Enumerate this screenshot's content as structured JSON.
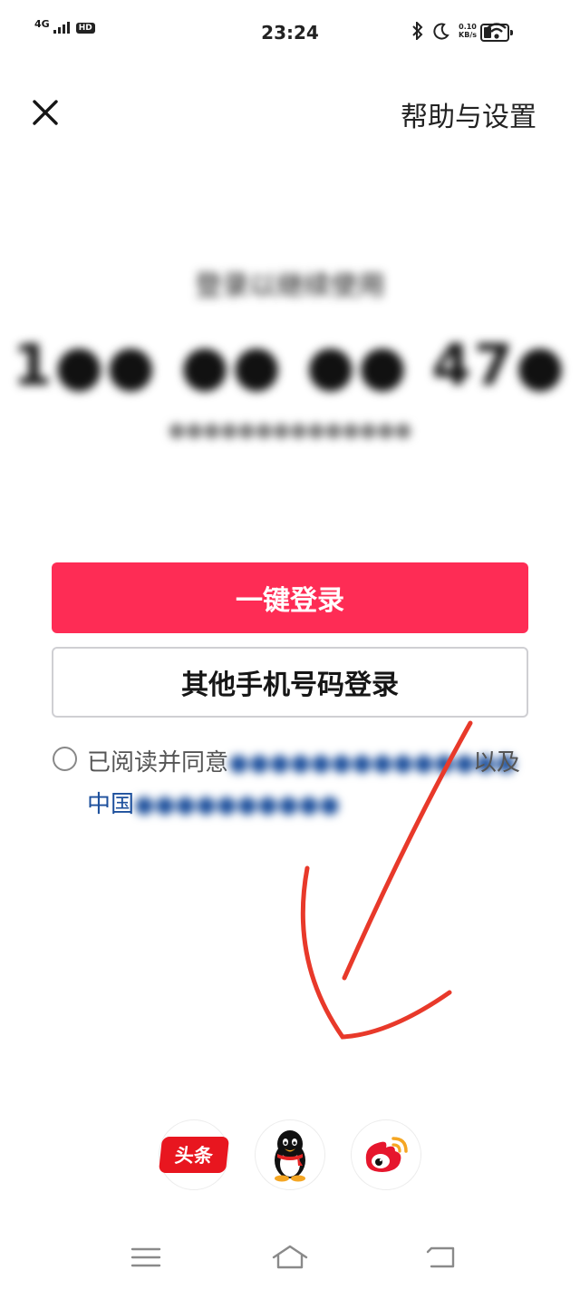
{
  "status_bar": {
    "network": "4G",
    "hd": "HD",
    "time": "23:24",
    "speed_value": "0.10",
    "speed_unit": "KB/s",
    "battery_level": 0.35
  },
  "header": {
    "close_icon": "close-icon",
    "help_label": "帮助与设置"
  },
  "login": {
    "title": "登录以继续使用",
    "phone": "1●● ●● ●● 47●",
    "carrier_note": "●●●●●●●●●●●●●●",
    "one_click_label": "一键登录",
    "other_phone_label": "其他手机号码登录"
  },
  "agreement": {
    "prefix": "已阅读并同意",
    "blurred_terms": "●●●●●●●●●●●●●●",
    "suffix": "以及",
    "carrier_prefix": "中国",
    "carrier_terms": "●●●●●●●●●●"
  },
  "third_party": {
    "toutiao_label": "头条",
    "qq_icon": "qq-penguin-icon",
    "weibo_icon": "weibo-icon"
  },
  "navbar": {
    "menu_icon": "menu-icon",
    "home_icon": "home-icon",
    "back_icon": "back-icon"
  },
  "colors": {
    "primary": "#fe2c55",
    "link": "#1c4f9c",
    "annotation": "#e8392a"
  }
}
